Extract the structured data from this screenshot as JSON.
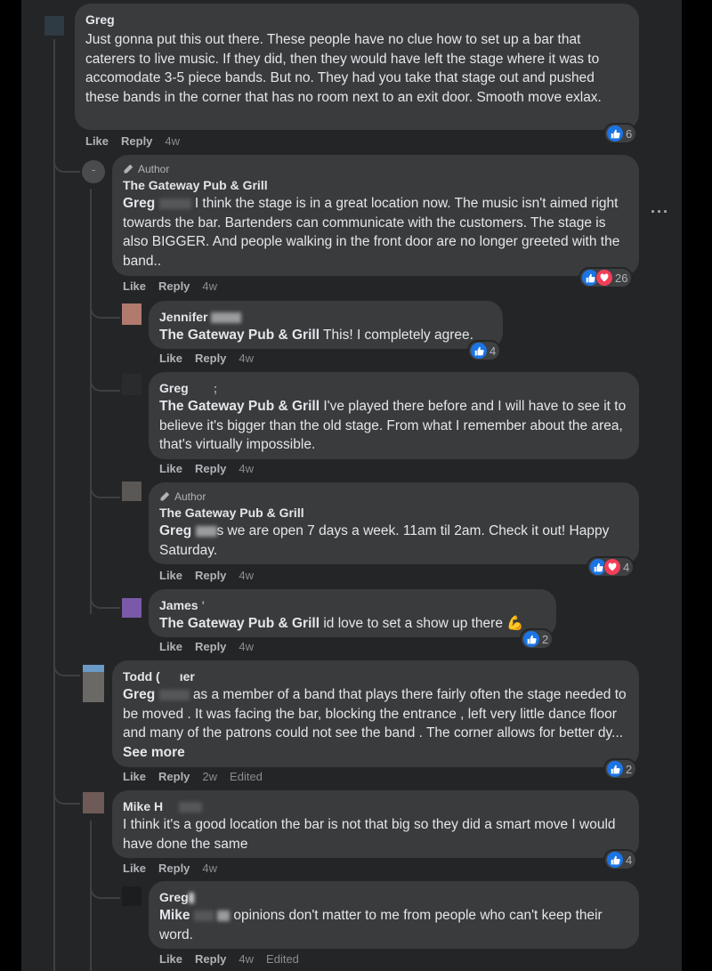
{
  "comments": [
    {
      "name": "Greg",
      "body": "Just gonna put this out there. These people have no clue how to set up a bar that caterers to live music. If they did, then they would have left the stage where it was to accomodate 3-5 piece bands. But no. They had you take that stage out and pushed these bands in the corner that has no room next to an exit door. Smooth move exlax.",
      "actions": {
        "like": "Like",
        "reply": "Reply",
        "time": "4w"
      },
      "reaction_count": "6"
    },
    {
      "author_tag": "Author",
      "name": "The Gateway Pub & Grill",
      "mention": "Greg",
      "body": "I think the stage is in a great location now. The music isn't aimed right towards the bar. Bartenders can communicate with the customers. The stage is also BIGGER. And people walking in the front door are no longer greeted with the band..",
      "actions": {
        "like": "Like",
        "reply": "Reply",
        "time": "4w"
      },
      "reaction_count": "26"
    },
    {
      "name": "Jennifer",
      "mention": "The Gateway Pub & Grill",
      "body": "This! I completely agree.",
      "actions": {
        "like": "Like",
        "reply": "Reply",
        "time": "4w"
      },
      "reaction_count": "4"
    },
    {
      "name": "Greg",
      "name_suffix": ";",
      "mention": "The Gateway Pub & Grill",
      "body": "I've played there before and I will have to see it to believe it's bigger than the old stage. From what I remember about the area, that's virtually impossible.",
      "actions": {
        "like": "Like",
        "reply": "Reply",
        "time": "4w"
      }
    },
    {
      "author_tag": "Author",
      "name": "The Gateway Pub & Grill",
      "mention": "Greg",
      "body": "s we are open 7 days a week. 11am til 2am. Check it out! Happy Saturday.",
      "actions": {
        "like": "Like",
        "reply": "Reply",
        "time": "4w"
      },
      "reaction_count": "4"
    },
    {
      "name": "James",
      "name_suffix": "'",
      "mention": "The Gateway Pub & Grill",
      "body": "id love to set a show up there",
      "actions": {
        "like": "Like",
        "reply": "Reply",
        "time": "4w"
      },
      "reaction_count": "2"
    },
    {
      "name": "Todd (",
      "name_suffix": "ıer",
      "mention": "Greg",
      "body": "as a member of a band that plays there fairly often the stage needed to be moved . It was facing the bar, blocking the entrance , left very little dance floor and many of the patrons could not see the band . The corner allows for better dy...",
      "see_more": "See more",
      "actions": {
        "like": "Like",
        "reply": "Reply",
        "time": "2w",
        "edited": "Edited"
      },
      "reaction_count": "2"
    },
    {
      "name": "Mike H",
      "body": "I think it's a good location the bar is not that big so they did a smart move I would have done the same",
      "actions": {
        "like": "Like",
        "reply": "Reply",
        "time": "4w"
      },
      "reaction_count": "4"
    },
    {
      "name": "Greg",
      "mention": "Mike",
      "body": "opinions don't matter to me from people who can't keep their word.",
      "actions": {
        "like": "Like",
        "reply": "Reply",
        "time": "4w",
        "edited": "Edited"
      }
    }
  ],
  "colors": {
    "background": "#242526",
    "bubble": "#3a3b3c",
    "like": "#1b74e4",
    "love": "#f33e58"
  },
  "icons": [
    "thumbs-up-icon",
    "heart-icon",
    "pencil-icon",
    "more-options-icon",
    "flexed-biceps-icon"
  ]
}
